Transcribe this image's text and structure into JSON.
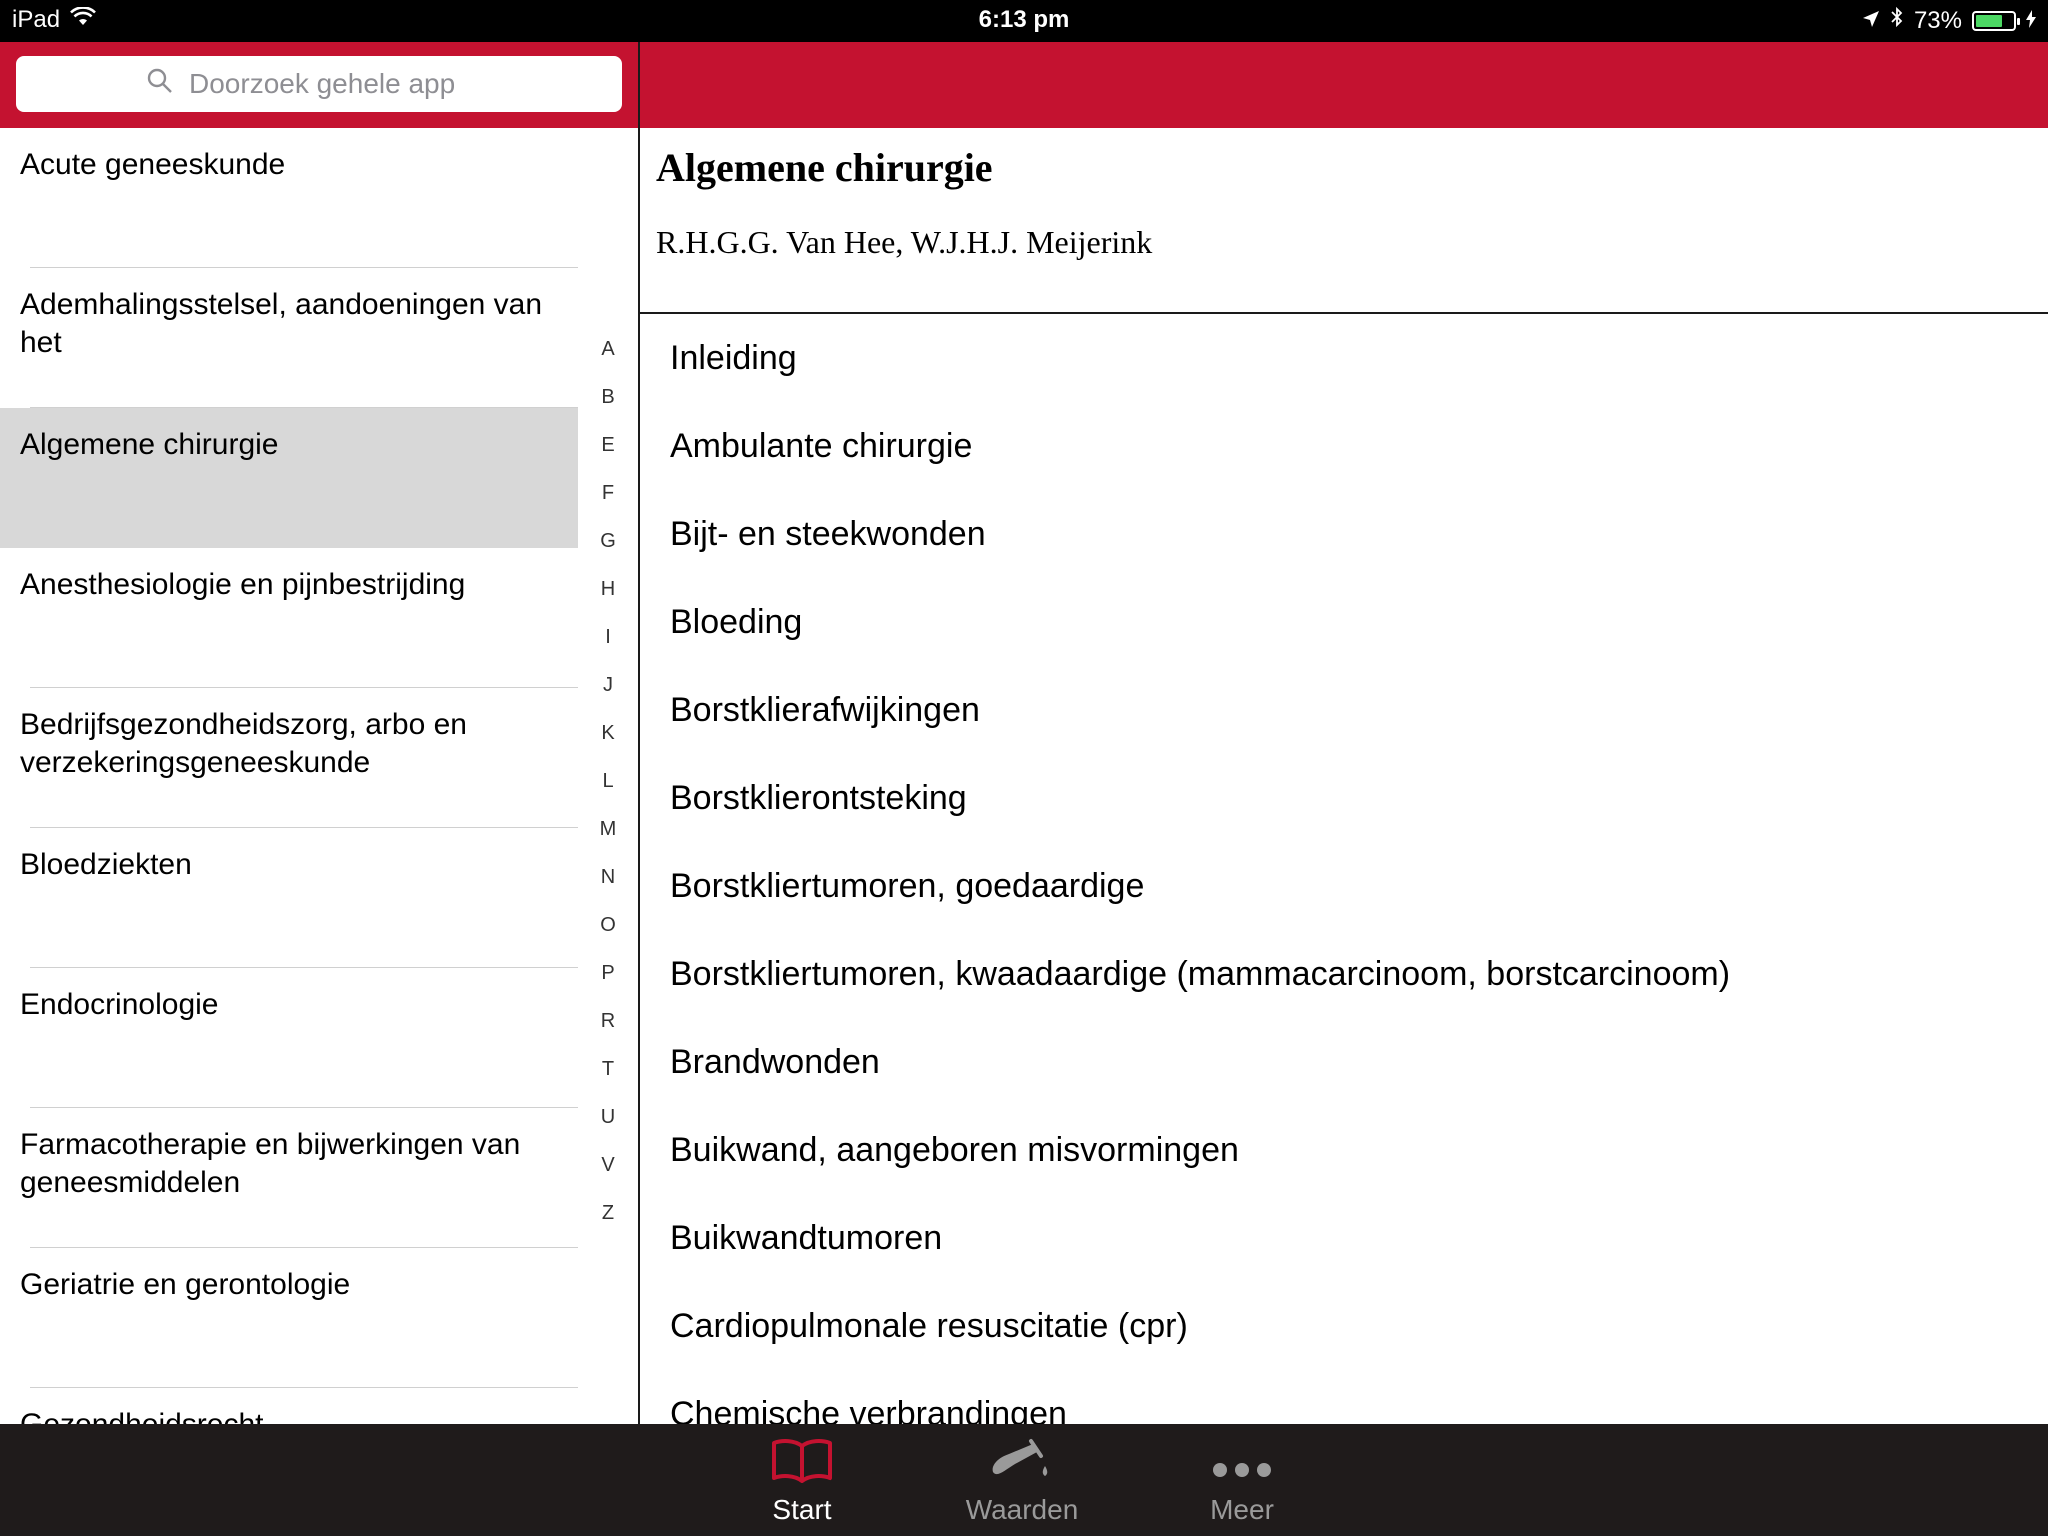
{
  "status_bar": {
    "device": "iPad",
    "time": "6:13 pm",
    "battery": "73%",
    "battery_fill": 0.73
  },
  "search": {
    "placeholder": "Doorzoek gehele app"
  },
  "left_list": {
    "items": [
      "Acute geneeskunde",
      "Ademhalingsstelsel, aandoeningen van het",
      "Algemene chirurgie",
      "Anesthesiologie en pijnbestrijding",
      "Bedrijfsgezondheidszorg, arbo en verzekeringsgeneeskunde",
      "Bloedziekten",
      "Endocrinologie",
      "Farmacotherapie en bijwerkingen van geneesmiddelen",
      "Geriatrie en gerontologie",
      "Gezondheidsrecht"
    ],
    "selected_index": 2
  },
  "index_letters": [
    "A",
    "B",
    "E",
    "F",
    "G",
    "H",
    "I",
    "J",
    "K",
    "L",
    "M",
    "N",
    "O",
    "P",
    "R",
    "T",
    "U",
    "V",
    "Z"
  ],
  "detail": {
    "title": "Algemene chirurgie",
    "authors": "R.H.G.G. Van Hee, W.J.H.J. Meijerink",
    "items": [
      "Inleiding",
      "Ambulante chirurgie",
      "Bijt- en steekwonden",
      "Bloeding",
      "Borstklierafwijkingen",
      "Borstklierontsteking",
      "Borstkliertumoren, goedaardige",
      "Borstkliertumoren, kwaadaardige (mammacarcinoom, borstcarcinoom)",
      "Brandwonden",
      "Buikwand, aangeboren misvormingen",
      "Buikwandtumoren",
      "Cardiopulmonale resuscitatie (cpr)",
      "Chemische verbrandingen"
    ]
  },
  "tabbar": {
    "tabs": [
      {
        "label": "Start",
        "icon": "book-icon",
        "active": true
      },
      {
        "label": "Waarden",
        "icon": "flask-icon",
        "active": false
      },
      {
        "label": "Meer",
        "icon": "more-dots-icon",
        "active": false
      }
    ],
    "accent_color": "#c41230"
  }
}
